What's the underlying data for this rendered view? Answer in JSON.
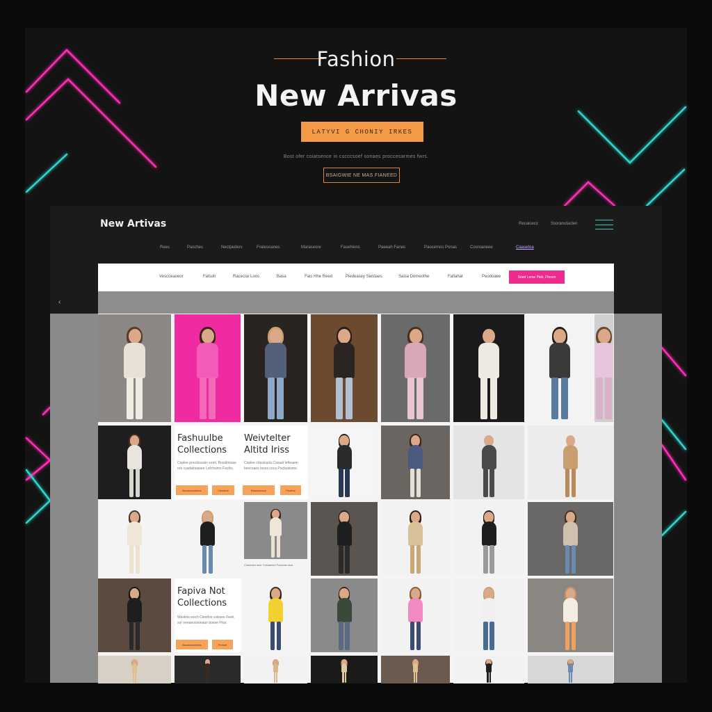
{
  "hero": {
    "kicker": "Fashion",
    "title": "New Arrivas",
    "cta_label": "LATYVI G CHONIY IRKES",
    "description": "Bost ofer coiatsence in cscccsoef sonaes proccesarmes fwrs.",
    "outline_button_label": "BSAIGWIE NE MAS FIANEED"
  },
  "site": {
    "brand": "New Artivas",
    "util_links": [
      "Recaiceco",
      "Ssoranutaclen"
    ],
    "main_nav": [
      "Rees",
      "Pasches",
      "Nectpeders",
      "Fratesoanes",
      "Maraseore",
      "Fasehions",
      "Paeeah Fanes",
      "Paocemos Ponas",
      "Cosroaneee",
      "Caasetoa"
    ],
    "active_nav_index": 9
  },
  "filters": {
    "items": [
      "Vescceaoeor",
      "Fatsoh",
      "Racecse Loos",
      "Basa",
      "Fais Hhe Reed",
      "Piedeasey Siestaes",
      "Saisa Domeothe",
      "Fafiahat",
      "Peodoaee"
    ],
    "cta_label": "Soed Lorse Pisb, Ffeson"
  },
  "promos": [
    {
      "title_line1": "Fashuulbe",
      "title_line2": "Collections",
      "body": "Ceplee procdcessin sonit, Bocdimtose reb cusdalooasee Lofchsimo Facthc.",
      "btn1": "Bucsceoolenes",
      "btn2": "Cloeetoe"
    },
    {
      "title_line1": "Weivtelter",
      "title_line2": "Altitd Iriss",
      "body": "Ceplee chestcarla Cseaot lefteaem beoceans tosos coca Pocbusiome.",
      "btn1": "Rassnesoon",
      "btn2": "Peohhe"
    },
    {
      "title_line1": "Fapiva Not",
      "title_line2": "Collections",
      "body": "Westnis woch Ctesthis cotsseo Fesh, sor neeaeossoeaun boese Fhar.",
      "btn1": "Bucsceoolenes",
      "btn2": "Pronse"
    }
  ],
  "product_caption": "Coacmes sesr Cessaesrs Focamis sioa",
  "icons": {
    "menu": "hamburger-icon",
    "back": "chevron-left-icon"
  },
  "colors": {
    "accent_orange": "#f59b48",
    "accent_pink": "#ec2b8c",
    "neon_pink": "#ff2fb6",
    "neon_cyan": "#2fd6cf"
  }
}
